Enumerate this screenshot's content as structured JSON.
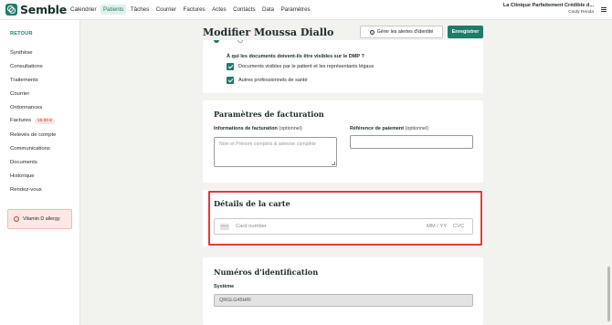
{
  "app": {
    "name": "Semble",
    "nav": [
      "Calendrier",
      "Patients",
      "Tâches",
      "Courrier",
      "Factures",
      "Actes",
      "Contacts",
      "Data",
      "Paramètres"
    ],
    "clinic_name": "La Clinique Parfaitement Crédible d...",
    "user_name": "Cindy Renda"
  },
  "sidebar": {
    "back": "RETOUR",
    "items": [
      {
        "label": "Synthèse"
      },
      {
        "label": "Consultations"
      },
      {
        "label": "Traitements"
      },
      {
        "label": "Courrier"
      },
      {
        "label": "Ordonnances"
      },
      {
        "label": "Factures",
        "badge": "15.00 €"
      },
      {
        "label": "Relevés de compte"
      },
      {
        "label": "Communications"
      },
      {
        "label": "Documents"
      },
      {
        "label": "Historique"
      },
      {
        "label": "Rendez-vous"
      }
    ],
    "allergy": "Vitamin D allergy"
  },
  "header": {
    "title": "Modifier Moussa Diallo",
    "alerts_button": "Gérer les alertes d'identité",
    "save_button": "Enregistrer"
  },
  "dmp": {
    "question": "À qui les documents doivent-ils être visibles sur le DMP ?",
    "options": [
      {
        "label": "Documents visibles par le patient et les représentants légaux",
        "checked": true
      },
      {
        "label": "Autres professionnels de santé",
        "checked": true
      }
    ]
  },
  "billing": {
    "title": "Paramètres de facturation",
    "info_label": "Informations de facturation",
    "info_optional": "(optionnel)",
    "info_placeholder": "Nom et Prénom complets & adresse complète",
    "ref_label": "Référence de paiement",
    "ref_optional": "(optionnel)"
  },
  "card": {
    "title": "Détails de la carte",
    "number_placeholder": "Card number",
    "expiry_placeholder": "MM / YY",
    "cvc_placeholder": "CVC"
  },
  "ids": {
    "title": "Numéros d'identification",
    "system_label": "Système",
    "system_value": "QRGLG45HRI"
  }
}
